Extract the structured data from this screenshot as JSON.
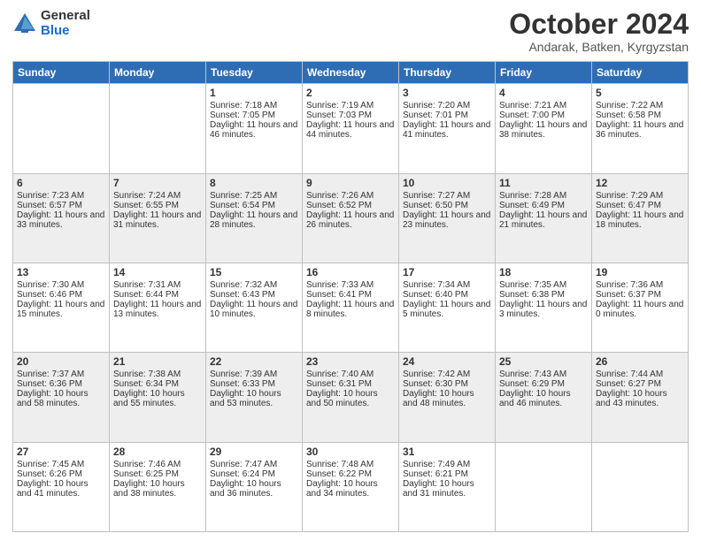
{
  "logo": {
    "general": "General",
    "blue": "Blue"
  },
  "header": {
    "month": "October 2024",
    "location": "Andarak, Batken, Kyrgyzstan"
  },
  "days_of_week": [
    "Sunday",
    "Monday",
    "Tuesday",
    "Wednesday",
    "Thursday",
    "Friday",
    "Saturday"
  ],
  "weeks": [
    [
      {
        "day": "",
        "sunrise": "",
        "sunset": "",
        "daylight": ""
      },
      {
        "day": "",
        "sunrise": "",
        "sunset": "",
        "daylight": ""
      },
      {
        "day": "1",
        "sunrise": "Sunrise: 7:18 AM",
        "sunset": "Sunset: 7:05 PM",
        "daylight": "Daylight: 11 hours and 46 minutes."
      },
      {
        "day": "2",
        "sunrise": "Sunrise: 7:19 AM",
        "sunset": "Sunset: 7:03 PM",
        "daylight": "Daylight: 11 hours and 44 minutes."
      },
      {
        "day": "3",
        "sunrise": "Sunrise: 7:20 AM",
        "sunset": "Sunset: 7:01 PM",
        "daylight": "Daylight: 11 hours and 41 minutes."
      },
      {
        "day": "4",
        "sunrise": "Sunrise: 7:21 AM",
        "sunset": "Sunset: 7:00 PM",
        "daylight": "Daylight: 11 hours and 38 minutes."
      },
      {
        "day": "5",
        "sunrise": "Sunrise: 7:22 AM",
        "sunset": "Sunset: 6:58 PM",
        "daylight": "Daylight: 11 hours and 36 minutes."
      }
    ],
    [
      {
        "day": "6",
        "sunrise": "Sunrise: 7:23 AM",
        "sunset": "Sunset: 6:57 PM",
        "daylight": "Daylight: 11 hours and 33 minutes."
      },
      {
        "day": "7",
        "sunrise": "Sunrise: 7:24 AM",
        "sunset": "Sunset: 6:55 PM",
        "daylight": "Daylight: 11 hours and 31 minutes."
      },
      {
        "day": "8",
        "sunrise": "Sunrise: 7:25 AM",
        "sunset": "Sunset: 6:54 PM",
        "daylight": "Daylight: 11 hours and 28 minutes."
      },
      {
        "day": "9",
        "sunrise": "Sunrise: 7:26 AM",
        "sunset": "Sunset: 6:52 PM",
        "daylight": "Daylight: 11 hours and 26 minutes."
      },
      {
        "day": "10",
        "sunrise": "Sunrise: 7:27 AM",
        "sunset": "Sunset: 6:50 PM",
        "daylight": "Daylight: 11 hours and 23 minutes."
      },
      {
        "day": "11",
        "sunrise": "Sunrise: 7:28 AM",
        "sunset": "Sunset: 6:49 PM",
        "daylight": "Daylight: 11 hours and 21 minutes."
      },
      {
        "day": "12",
        "sunrise": "Sunrise: 7:29 AM",
        "sunset": "Sunset: 6:47 PM",
        "daylight": "Daylight: 11 hours and 18 minutes."
      }
    ],
    [
      {
        "day": "13",
        "sunrise": "Sunrise: 7:30 AM",
        "sunset": "Sunset: 6:46 PM",
        "daylight": "Daylight: 11 hours and 15 minutes."
      },
      {
        "day": "14",
        "sunrise": "Sunrise: 7:31 AM",
        "sunset": "Sunset: 6:44 PM",
        "daylight": "Daylight: 11 hours and 13 minutes."
      },
      {
        "day": "15",
        "sunrise": "Sunrise: 7:32 AM",
        "sunset": "Sunset: 6:43 PM",
        "daylight": "Daylight: 11 hours and 10 minutes."
      },
      {
        "day": "16",
        "sunrise": "Sunrise: 7:33 AM",
        "sunset": "Sunset: 6:41 PM",
        "daylight": "Daylight: 11 hours and 8 minutes."
      },
      {
        "day": "17",
        "sunrise": "Sunrise: 7:34 AM",
        "sunset": "Sunset: 6:40 PM",
        "daylight": "Daylight: 11 hours and 5 minutes."
      },
      {
        "day": "18",
        "sunrise": "Sunrise: 7:35 AM",
        "sunset": "Sunset: 6:38 PM",
        "daylight": "Daylight: 11 hours and 3 minutes."
      },
      {
        "day": "19",
        "sunrise": "Sunrise: 7:36 AM",
        "sunset": "Sunset: 6:37 PM",
        "daylight": "Daylight: 11 hours and 0 minutes."
      }
    ],
    [
      {
        "day": "20",
        "sunrise": "Sunrise: 7:37 AM",
        "sunset": "Sunset: 6:36 PM",
        "daylight": "Daylight: 10 hours and 58 minutes."
      },
      {
        "day": "21",
        "sunrise": "Sunrise: 7:38 AM",
        "sunset": "Sunset: 6:34 PM",
        "daylight": "Daylight: 10 hours and 55 minutes."
      },
      {
        "day": "22",
        "sunrise": "Sunrise: 7:39 AM",
        "sunset": "Sunset: 6:33 PM",
        "daylight": "Daylight: 10 hours and 53 minutes."
      },
      {
        "day": "23",
        "sunrise": "Sunrise: 7:40 AM",
        "sunset": "Sunset: 6:31 PM",
        "daylight": "Daylight: 10 hours and 50 minutes."
      },
      {
        "day": "24",
        "sunrise": "Sunrise: 7:42 AM",
        "sunset": "Sunset: 6:30 PM",
        "daylight": "Daylight: 10 hours and 48 minutes."
      },
      {
        "day": "25",
        "sunrise": "Sunrise: 7:43 AM",
        "sunset": "Sunset: 6:29 PM",
        "daylight": "Daylight: 10 hours and 46 minutes."
      },
      {
        "day": "26",
        "sunrise": "Sunrise: 7:44 AM",
        "sunset": "Sunset: 6:27 PM",
        "daylight": "Daylight: 10 hours and 43 minutes."
      }
    ],
    [
      {
        "day": "27",
        "sunrise": "Sunrise: 7:45 AM",
        "sunset": "Sunset: 6:26 PM",
        "daylight": "Daylight: 10 hours and 41 minutes."
      },
      {
        "day": "28",
        "sunrise": "Sunrise: 7:46 AM",
        "sunset": "Sunset: 6:25 PM",
        "daylight": "Daylight: 10 hours and 38 minutes."
      },
      {
        "day": "29",
        "sunrise": "Sunrise: 7:47 AM",
        "sunset": "Sunset: 6:24 PM",
        "daylight": "Daylight: 10 hours and 36 minutes."
      },
      {
        "day": "30",
        "sunrise": "Sunrise: 7:48 AM",
        "sunset": "Sunset: 6:22 PM",
        "daylight": "Daylight: 10 hours and 34 minutes."
      },
      {
        "day": "31",
        "sunrise": "Sunrise: 7:49 AM",
        "sunset": "Sunset: 6:21 PM",
        "daylight": "Daylight: 10 hours and 31 minutes."
      },
      {
        "day": "",
        "sunrise": "",
        "sunset": "",
        "daylight": ""
      },
      {
        "day": "",
        "sunrise": "",
        "sunset": "",
        "daylight": ""
      }
    ]
  ]
}
